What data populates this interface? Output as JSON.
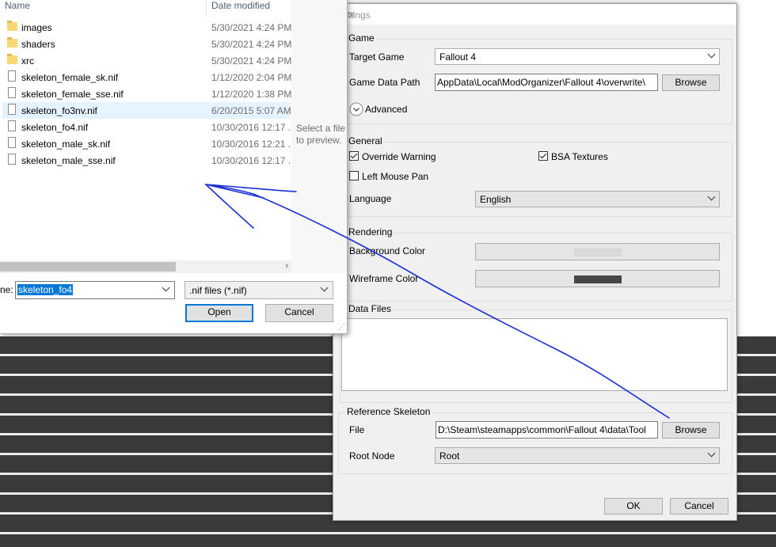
{
  "settings": {
    "title": "ttings",
    "game_group": "Game",
    "target_game_label": "Target Game",
    "target_game_value": "Fallout 4",
    "game_data_path_label": "Game Data Path",
    "game_data_path_value": "AppData\\Local\\ModOrganizer\\Fallout 4\\overwrite\\",
    "browse": "Browse",
    "advanced": "Advanced",
    "general_group": "General",
    "override_warning": "Override Warning",
    "bsa_textures": "BSA Textures",
    "left_mouse_pan": "Left Mouse Pan",
    "language_label": "Language",
    "language_value": "English",
    "rendering_group": "Rendering",
    "background_color_label": "Background Color",
    "wireframe_color_label": "Wireframe Color",
    "data_files_group": "Data Files",
    "ref_skeleton_group": "Reference Skeleton",
    "file_label": "File",
    "file_value": "D:\\Steam\\steamapps\\common\\Fallout 4\\data\\Tool",
    "root_node_label": "Root Node",
    "root_node_value": "Root",
    "ok": "OK",
    "cancel": "Cancel",
    "colors": {
      "background_swatch": "#d9d9d9",
      "wireframe_swatch": "#464646"
    }
  },
  "file_dialog": {
    "col_name": "Name",
    "col_date": "Date modified",
    "files": [
      {
        "name": "images",
        "date": "5/30/2021 4:24 PM",
        "type": "folder"
      },
      {
        "name": "shaders",
        "date": "5/30/2021 4:24 PM",
        "type": "folder"
      },
      {
        "name": "xrc",
        "date": "5/30/2021 4:24 PM",
        "type": "folder"
      },
      {
        "name": "skeleton_female_sk.nif",
        "date": "1/12/2020 2:04 PM",
        "type": "file"
      },
      {
        "name": "skeleton_female_sse.nif",
        "date": "1/12/2020 1:38 PM",
        "type": "file"
      },
      {
        "name": "skeleton_fo3nv.nif",
        "date": "6/20/2015 5:07 AM",
        "type": "file"
      },
      {
        "name": "skeleton_fo4.nif",
        "date": "10/30/2016 12:17 ...",
        "type": "file"
      },
      {
        "name": "skeleton_male_sk.nif",
        "date": "10/30/2016 12:21 ...",
        "type": "file"
      },
      {
        "name": "skeleton_male_sse.nif",
        "date": "10/30/2016 12:17 ...",
        "type": "file"
      }
    ],
    "preview_text": "Select a file to preview.",
    "filename_label": "ne:",
    "filename_value": "skeleton_fo4",
    "filter_value": ".nif files (*.nif)",
    "open": "Open",
    "cancel": "Cancel"
  }
}
